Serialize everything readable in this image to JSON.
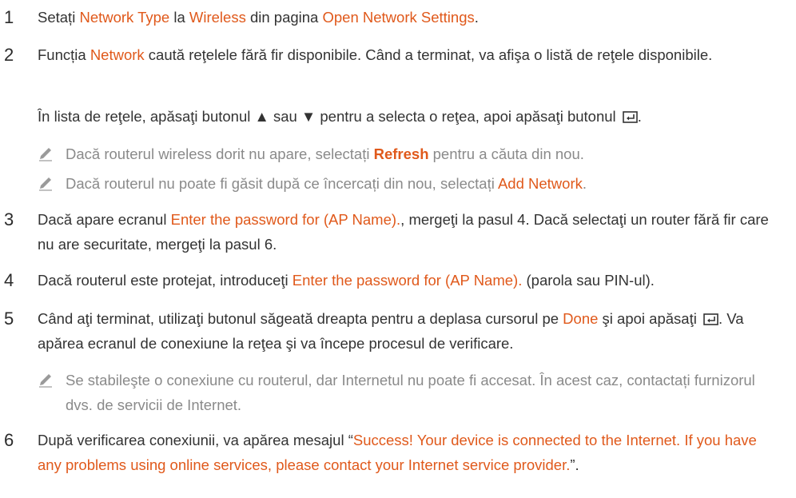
{
  "steps": [
    {
      "num": "1",
      "p1": "Setați ",
      "h1": "Network Type",
      "p2": " la ",
      "h2": "Wireless",
      "p3": " din pagina ",
      "h3": "Open Network Settings",
      "p4": "."
    },
    {
      "num": "2",
      "p1": "Funcția ",
      "h1": "Network",
      "p2": " caută reţelele fără fir disponibile. Când a terminat, va afişa o listă de reţele disponibile.",
      "para": "În lista de reţele, apăsaţi butonul ▲ sau ▼ pentru a selecta o reţea, apoi apăsaţi butonul ",
      "para_end": ".",
      "note1": {
        "t1": "Dacă routerul wireless dorit nu apare, selectați ",
        "b": "Refresh",
        "t2": " pentru a căuta din nou."
      },
      "note2": {
        "t1": "Dacă routerul nu poate fi găsit după ce încercați din nou, selectați ",
        "b": "Add Network",
        "t2": "."
      }
    },
    {
      "num": "3",
      "p1": "Dacă apare ecranul ",
      "h1": "Enter the password for (AP Name).",
      "p2": ", mergeţi la pasul 4. Dacă selectaţi un router fără fir care nu are securitate, mergeţi la pasul 6."
    },
    {
      "num": "4",
      "p1": "Dacă routerul este protejat, introduceţi ",
      "h1": "Enter the password for (AP Name).",
      "p2": " (parola sau PIN-ul)."
    },
    {
      "num": "5",
      "p1": "Când aţi terminat, utilizaţi butonul săgeată dreapta pentru a deplasa cursorul pe ",
      "h1": "Done",
      "p2": " şi apoi apăsaţi ",
      "p3": ". Va apărea ecranul de conexiune la reţea şi va începe procesul de verificare.",
      "note1": {
        "t1": "Se stabileşte o conexiune cu routerul, dar Internetul nu poate fi accesat. În acest caz, contactați furnizorul dvs. de servicii de Internet."
      }
    },
    {
      "num": "6",
      "p1": "După verificarea conexiunii, va apărea mesajul “",
      "h1": "Success! Your device is connected to the Internet. If you have any problems using online services, please contact your Internet service provider.",
      "p2": "”."
    }
  ],
  "colors": {
    "highlight": "#e0591b",
    "text": "#333333",
    "note": "#8a8a8a"
  },
  "icons": {
    "note": "pencil-note-icon",
    "enter": "enter-key-icon"
  }
}
